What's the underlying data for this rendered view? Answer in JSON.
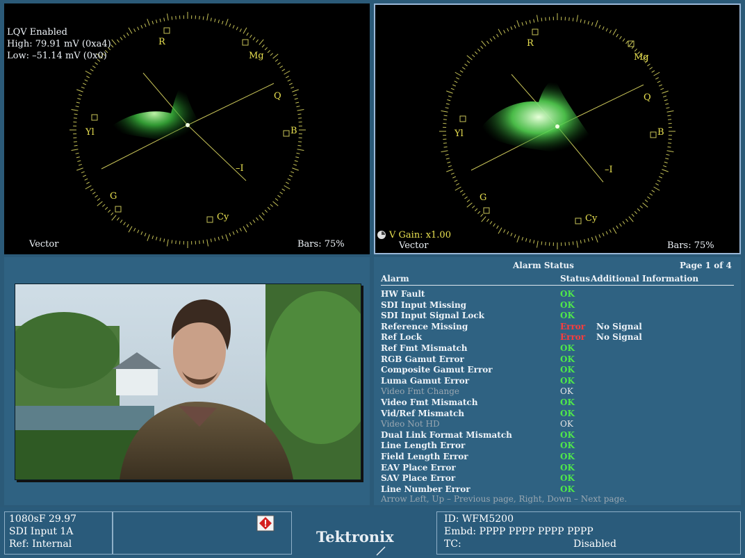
{
  "vector_left": {
    "lqv_label": "LQV Enabled",
    "high_label": "High: 79.91 mV (0xa4)",
    "low_label": "Low: –51.14 mV (0x0)",
    "mode_label": "Vector",
    "bars_label": "Bars: 75%",
    "targets": {
      "r": "R",
      "mg": "Mg",
      "q": "Q",
      "b": "B",
      "yl": "Yl",
      "i": "–I",
      "g": "G",
      "cy": "Cy"
    }
  },
  "vector_right": {
    "gain_label": "V Gain: x1.00",
    "mode_label": "Vector",
    "bars_label": "Bars: 75%",
    "targets": {
      "r": "R",
      "mg": "Mg",
      "q": "Q",
      "b": "B",
      "yl": "Yl",
      "i": "–I",
      "g": "G",
      "cy": "Cy"
    }
  },
  "alarm_status": {
    "title": "Alarm Status",
    "page": "Page 1 of 4",
    "col_alarm": "Alarm",
    "col_status": "Status",
    "col_info": "Additional Information",
    "rows": [
      {
        "name": "HW Fault",
        "status": "OK",
        "info": "",
        "kind": "ok"
      },
      {
        "name": "SDI Input Missing",
        "status": "OK",
        "info": "",
        "kind": "ok"
      },
      {
        "name": "SDI Input Signal Lock",
        "status": "OK",
        "info": "",
        "kind": "ok"
      },
      {
        "name": "Reference Missing",
        "status": "Error",
        "info": "No Signal",
        "kind": "err"
      },
      {
        "name": "Ref Lock",
        "status": "Error",
        "info": "No Signal",
        "kind": "err"
      },
      {
        "name": "Ref Fmt Mismatch",
        "status": "OK",
        "info": "",
        "kind": "ok"
      },
      {
        "name": "RGB Gamut Error",
        "status": "OK",
        "info": "",
        "kind": "ok"
      },
      {
        "name": "Composite Gamut Error",
        "status": "OK",
        "info": "",
        "kind": "ok"
      },
      {
        "name": "Luma Gamut Error",
        "status": "OK",
        "info": "",
        "kind": "ok"
      },
      {
        "name": "Video Fmt Change",
        "status": "OK",
        "info": "",
        "kind": "dim"
      },
      {
        "name": "Video Fmt Mismatch",
        "status": "OK",
        "info": "",
        "kind": "ok"
      },
      {
        "name": "Vid/Ref Mismatch",
        "status": "OK",
        "info": "",
        "kind": "ok"
      },
      {
        "name": "Video Not HD",
        "status": "OK",
        "info": "",
        "kind": "dim"
      },
      {
        "name": "Dual Link Format Mismatch",
        "status": "OK",
        "info": "",
        "kind": "ok"
      },
      {
        "name": "Line Length Error",
        "status": "OK",
        "info": "",
        "kind": "ok"
      },
      {
        "name": "Field Length Error",
        "status": "OK",
        "info": "",
        "kind": "ok"
      },
      {
        "name": "EAV Place Error",
        "status": "OK",
        "info": "",
        "kind": "ok"
      },
      {
        "name": "SAV Place Error",
        "status": "OK",
        "info": "",
        "kind": "ok"
      },
      {
        "name": "Line Number Error",
        "status": "OK",
        "info": "",
        "kind": "ok"
      }
    ],
    "footer": "Arrow Left, Up – Previous page, Right, Down – Next page.",
    "colors": {
      "ok": "#4fe84a",
      "error": "#ff3c3c"
    }
  },
  "status_bar": {
    "format": "1080sF 29.97",
    "input": "SDI Input 1A",
    "ref": "Ref: Internal",
    "brand": "Tektronix",
    "id": "ID: WFM5200",
    "embd": "Embd: PPPP PPPP PPPP PPPP",
    "tc_label": "TC:",
    "tc_value": "Disabled",
    "warning_icon": "warning-icon"
  }
}
